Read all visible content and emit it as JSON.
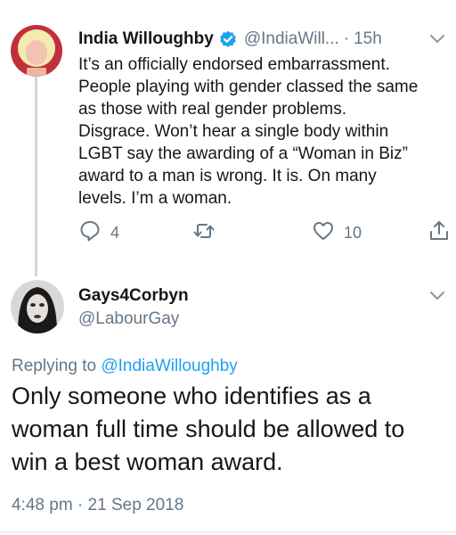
{
  "tweet1": {
    "author_name": "India Willoughby",
    "handle": "@IndiaWill...",
    "separator": "·",
    "time": "15h",
    "body_lines": [
      "It’s an officially endorsed embarrassment.",
      "People playing with gender classed the same",
      "as those with real gender problems.",
      "Disgrace. Won’t hear a single body within",
      "LGBT say the awarding of a “Woman in Biz”",
      "award to a man is wrong. It is. On many",
      "levels. I’m a woman."
    ],
    "reply_count": "4",
    "like_count": "10",
    "icons": {
      "verified": "verified-badge-icon",
      "reply": "reply-icon",
      "retweet": "retweet-icon",
      "like": "heart-icon",
      "share": "share-icon",
      "menu": "chevron-down-icon"
    }
  },
  "tweet2": {
    "author_name": "Gays4Corbyn",
    "handle": "@LabourGay",
    "replying_prefix": "Replying to",
    "replying_to": "@IndiaWilloughby",
    "body_lines": [
      "Only someone who identifies as a",
      "woman full time should be allowed to",
      "win a best woman award."
    ],
    "timestamp": "4:48 pm · 21 Sep 2018"
  },
  "colors": {
    "accent": "#1da1f2",
    "secondary_text": "#657786",
    "primary_text": "#14171a",
    "thread_line": "#ccd6dd"
  }
}
